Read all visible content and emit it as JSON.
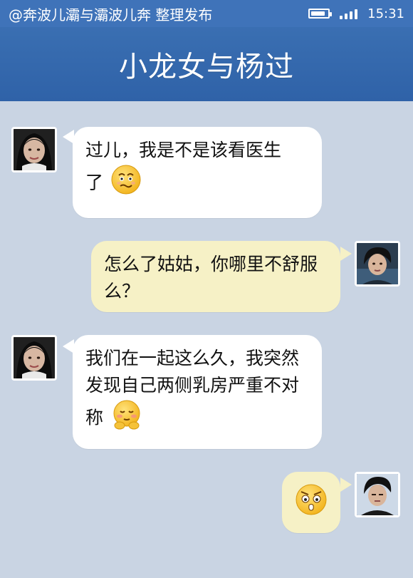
{
  "status": {
    "source_label": "@奔波儿灞与灞波儿奔 整理发布",
    "time": "15:31",
    "battery_level": 0.85,
    "signal_bars": 4
  },
  "header": {
    "title": "小龙女与杨过"
  },
  "messages": [
    {
      "side": "left",
      "sender": "xiaolongnu",
      "lines": [
        "过儿，我是不是该看医生",
        "了"
      ],
      "emoji": "worried-face-icon"
    },
    {
      "side": "right",
      "sender": "yangguo",
      "lines": [
        "怎么了姑姑，你哪里不舒服",
        "么？"
      ]
    },
    {
      "side": "left",
      "sender": "xiaolongnu",
      "lines": [
        "我们在一起这么久，我突然",
        "发现自己两侧乳房严重不对",
        "称"
      ],
      "emoji": "blushing-face-icon"
    },
    {
      "side": "right",
      "sender": "yangguo",
      "lines": [],
      "emoji": "shocked-face-icon"
    }
  ],
  "colors": {
    "header_blue": "#3a6fb2",
    "chat_background": "#c9d4e3",
    "left_bubble": "#ffffff",
    "right_bubble": "#f6f1c6"
  }
}
